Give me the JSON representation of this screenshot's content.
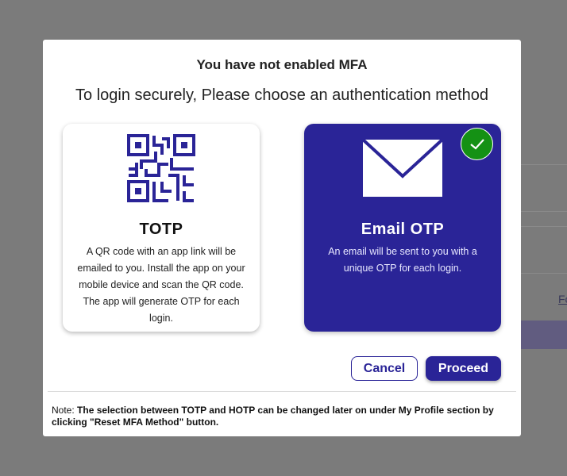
{
  "modal": {
    "title": "You have not enabled MFA",
    "subtitle": "To login securely, Please choose an authentication method",
    "options": [
      {
        "icon": "qr-code-icon",
        "title": "TOTP",
        "description": "A QR code with an app link will be emailed to you. Install the app on your mobile device and scan the QR code. The app will generate OTP for each login.",
        "selected": false
      },
      {
        "icon": "envelope-icon",
        "title": "Email OTP",
        "description": "An email will be sent to you with a unique OTP for each login.",
        "selected": true
      }
    ],
    "cancel_label": "Cancel",
    "proceed_label": "Proceed",
    "note_prefix": "Note:",
    "note_text": "The selection between TOTP and HOTP can be changed later on under My Profile section by clicking \"Reset MFA Method\" button."
  },
  "background": {
    "partial_link": "Fo"
  },
  "colors": {
    "accent": "#2a2497",
    "selected_check": "#149114",
    "overlay": "#7b7b7b"
  }
}
